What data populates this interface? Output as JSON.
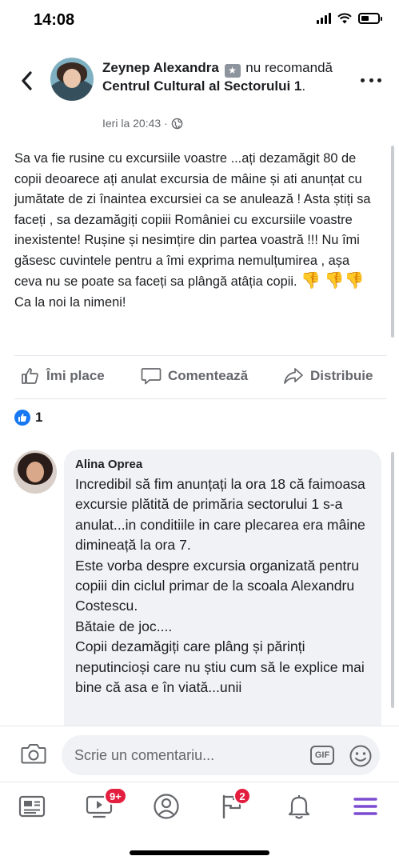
{
  "status_bar": {
    "time": "14:08"
  },
  "post": {
    "author": "Zeynep Alexandra",
    "verb_before": "nu",
    "verb": "recomandă",
    "page_name": "Centrul Cultural al Sectorului 1",
    "page_suffix": ".",
    "timestamp": "Ieri la 20:43",
    "timestamp_sep": "·",
    "privacy_icon": "globe-icon",
    "text_main": "Sa va fie rusine cu excursiile voastre ...ați dezamăgit 80 de copii deoarece ați anulat excursia de mâine și ati anunțat cu jumătate de zi înaintea excursiei ca se anulează ! Asta știți sa faceți , sa dezamăgiți copiii României cu excursiile voastre inexistente! Rușine și nesimțire din partea voastră !!! Nu îmi găsesc cuvintele pentru a îmi exprima nemulțumirea , așa ceva nu se poate sa faceți sa plângă atâția copii.",
    "text_emoji_1": "👎",
    "text_emoji_2": "👎👎",
    "text_end": "Ca la noi la nimeni!"
  },
  "actions": {
    "like_label": "Îmi place",
    "comment_label": "Comentează",
    "share_label": "Distribuie"
  },
  "reactions": {
    "count": "1"
  },
  "comment": {
    "author": "Alina Oprea",
    "text": "Incredibil să fim anunțați la ora 18 că faimoasa excursie plătită de primăria sectorului 1 s-a anulat...in conditiile in care plecarea era mâine dimineață la ora 7.\nEste vorba despre excursia organizată pentru copiii din ciclul primar de la scoala Alexandru Costescu.\nBătaie de joc....\nCopii dezamăgiți care plâng și părinți neputincioși care nu știu cum să le explice mai bine că asa e în viată...unii"
  },
  "composer": {
    "placeholder": "Scrie un comentariu...",
    "gif_label": "GIF"
  },
  "tab_bar": {
    "video_badge": "9+",
    "pages_badge": "2"
  },
  "colors": {
    "accent": "#1877f2",
    "menu_active": "#7b4bd0",
    "badge": "#e41e3f"
  }
}
